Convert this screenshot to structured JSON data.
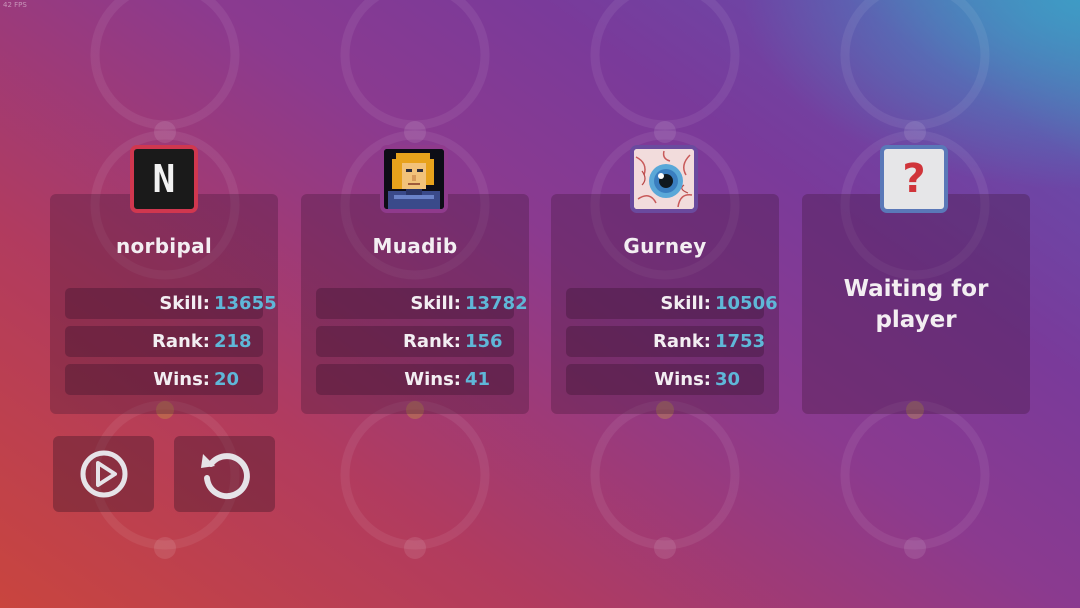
{
  "fps_label": "42 FPS",
  "players": [
    {
      "name": "norbipal",
      "avatar_icon": "letter-n-avatar",
      "avatar_letter": "N",
      "border_color": "#d0374f",
      "stats": [
        {
          "label": "Skill:",
          "value": "13655"
        },
        {
          "label": "Rank:",
          "value": "218"
        },
        {
          "label": "Wins:",
          "value": "20"
        }
      ]
    },
    {
      "name": "Muadib",
      "avatar_icon": "pixel-warrior-avatar",
      "border_color": "#8f3a8c",
      "stats": [
        {
          "label": "Skill:",
          "value": "13782"
        },
        {
          "label": "Rank:",
          "value": "156"
        },
        {
          "label": "Wins:",
          "value": "41"
        }
      ]
    },
    {
      "name": "Gurney",
      "avatar_icon": "eyeball-avatar",
      "border_color": "#6a4a9e",
      "stats": [
        {
          "label": "Skill:",
          "value": "10506"
        },
        {
          "label": "Rank:",
          "value": "1753"
        },
        {
          "label": "Wins:",
          "value": "30"
        }
      ]
    },
    {
      "waiting_text": "Waiting for player",
      "avatar_icon": "question-mark-avatar",
      "avatar_symbol": "?",
      "border_color": "#5a78b8"
    }
  ],
  "controls": {
    "play_icon": "play-icon",
    "restart_icon": "restart-icon"
  },
  "colors": {
    "stat_value": "#5fb7d8",
    "text": "#f3eef2"
  }
}
